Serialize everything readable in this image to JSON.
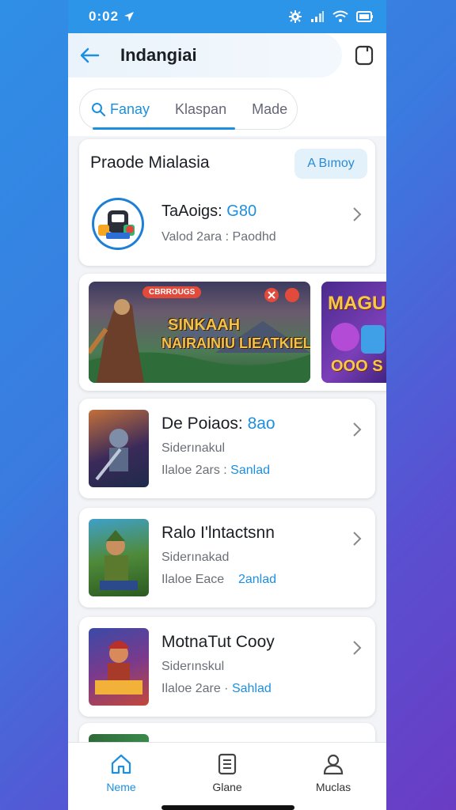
{
  "status": {
    "time": "0:02",
    "icons": [
      "location-icon",
      "settings-gear-icon",
      "signal-icon",
      "wifi-icon",
      "battery-icon"
    ]
  },
  "appbar": {
    "title": "Indangiai"
  },
  "tabs": [
    {
      "label": "Fanay",
      "active": true,
      "icon": "search-icon"
    },
    {
      "label": "Klaspan",
      "active": false
    },
    {
      "label": "Made",
      "active": false
    }
  ],
  "featured": {
    "title": "Praode Mialasia",
    "button_label": "A Bımoy",
    "app": {
      "name": "TaAoigs: ",
      "name_accent": "G80",
      "meta": "Valod 2ara  :  Paodhd"
    }
  },
  "banners": [
    {
      "badge": "CBRROUGS",
      "title_line1": "SINKAAH",
      "title_line2": "NAIRAINIU LIEATKIEL"
    },
    {
      "title_line1": "MAGUH",
      "title_line2": "OOO S"
    }
  ],
  "games": [
    {
      "title": "De Poiaos: ",
      "title_accent": "8ao",
      "subtitle": "Siderınakul",
      "meta_left": "Ilaloe 2ars  :",
      "meta_right": "Sanlad"
    },
    {
      "title": "Ralo I'lntactsnn",
      "title_accent": "",
      "subtitle": "Siderınakad",
      "meta_left": "Ilaloe Eace",
      "meta_right": "2anlad"
    },
    {
      "title": "MotnaTut Cooy",
      "title_accent": "",
      "subtitle": "Siderınskul",
      "meta_left": "Ilaloe 2are  ·",
      "meta_right": "Sahlad"
    }
  ],
  "bottom_nav": [
    {
      "label": "Neme",
      "icon": "home-icon",
      "active": true
    },
    {
      "label": "Glane",
      "icon": "list-icon",
      "active": false
    },
    {
      "label": "Muclas",
      "icon": "profile-icon",
      "active": false
    }
  ],
  "colors": {
    "accent": "#1d8fe0",
    "status_bar": "#2c95e8"
  }
}
